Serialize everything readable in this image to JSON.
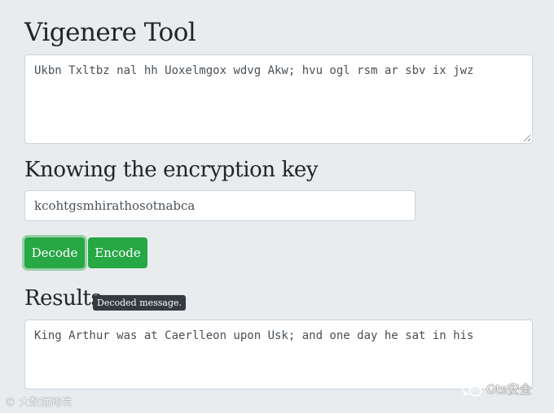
{
  "app": {
    "title": "Vigenere Tool"
  },
  "cipher_input": {
    "value": "Ukbn Txltbz nal hh Uoxelmgox wdvg Akw; hvu ogl rsm ar sbv ix jwz"
  },
  "key_section": {
    "heading": "Knowing the encryption key",
    "key_value": "kcohtgsmhirathosotnabca"
  },
  "buttons": {
    "decode_label": "Decode",
    "encode_label": "Encode"
  },
  "results": {
    "heading": "Results",
    "tooltip": "Decoded message.",
    "value": "King Arthur was at Caerlleon upon Usk; and one day he sat in his"
  },
  "watermarks": {
    "left": "©  大数据跨境",
    "right": "Ots安全",
    "right_icon": "wechat-icon"
  },
  "colors": {
    "background": "#e9ecef",
    "button_green": "#28a745",
    "tooltip_bg": "#343a40"
  }
}
